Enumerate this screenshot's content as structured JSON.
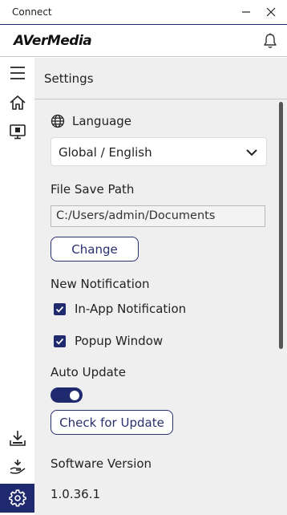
{
  "window": {
    "title": "Connect"
  },
  "header": {
    "brand": "AVerMedia",
    "notification_icon": "bell-icon"
  },
  "sidebar": {
    "items": [
      {
        "icon": "menu-icon",
        "active": false
      },
      {
        "icon": "home-icon",
        "active": false
      },
      {
        "icon": "monitor-icon",
        "active": false
      },
      {
        "icon": "download-icon",
        "active": false
      },
      {
        "icon": "hand-support-icon",
        "active": false
      },
      {
        "icon": "gear-icon",
        "active": true
      }
    ]
  },
  "settings": {
    "title": "Settings",
    "language": {
      "label": "Language",
      "selected": "Global / English"
    },
    "file_save_path": {
      "label": "File Save Path",
      "value": "C:/Users/admin/Documents",
      "change_label": "Change"
    },
    "new_notification": {
      "label": "New Notification",
      "options": [
        {
          "label": "In-App Notification",
          "checked": true
        },
        {
          "label": "Popup Window",
          "checked": true
        }
      ]
    },
    "auto_update": {
      "label": "Auto Update",
      "enabled": true,
      "check_label": "Check for Update"
    },
    "software_version": {
      "label": "Software Version",
      "value": "1.0.36.1"
    }
  },
  "colors": {
    "accent": "#1f2a6e",
    "content_bg": "#efefef"
  }
}
